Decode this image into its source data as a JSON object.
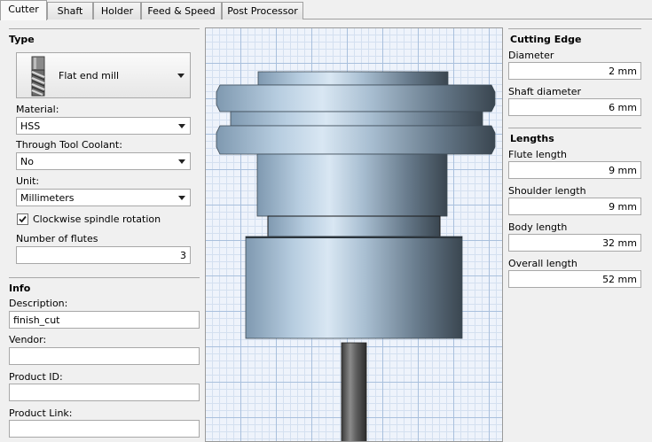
{
  "tabs": [
    {
      "label": "Cutter",
      "active": true
    },
    {
      "label": "Shaft"
    },
    {
      "label": "Holder"
    },
    {
      "label": "Feed & Speed"
    },
    {
      "label": "Post Processor"
    }
  ],
  "type_section": {
    "title": "Type",
    "tool_type": "Flat end mill",
    "tool_icon": "end-mill-icon",
    "material_label": "Material:",
    "material_value": "HSS",
    "coolant_label": "Through Tool Coolant:",
    "coolant_value": "No",
    "unit_label": "Unit:",
    "unit_value": "Millimeters",
    "clockwise_label": "Clockwise spindle rotation",
    "clockwise_checked": true,
    "flutes_label": "Number of flutes",
    "flutes_value": "3"
  },
  "info_section": {
    "title": "Info",
    "description_label": "Description:",
    "description_value": "finish_cut",
    "vendor_label": "Vendor:",
    "vendor_value": "",
    "product_id_label": "Product ID:",
    "product_id_value": "",
    "product_link_label": "Product Link:",
    "product_link_value": ""
  },
  "cutting_edge": {
    "title": "Cutting Edge",
    "diameter_label": "Diameter",
    "diameter_value": "2 mm",
    "shaft_diameter_label": "Shaft diameter",
    "shaft_diameter_value": "6 mm"
  },
  "lengths": {
    "title": "Lengths",
    "flute_length_label": "Flute length",
    "flute_length_value": "9 mm",
    "shoulder_length_label": "Shoulder length",
    "shoulder_length_value": "9 mm",
    "body_length_label": "Body length",
    "body_length_value": "32 mm",
    "overall_length_label": "Overall length",
    "overall_length_value": "52 mm"
  },
  "colors": {
    "holder_light": "#c9dcec",
    "holder_mid": "#8fa9c0",
    "holder_dark": "#3f4d58",
    "tool_steel": "#5a5a5a"
  }
}
